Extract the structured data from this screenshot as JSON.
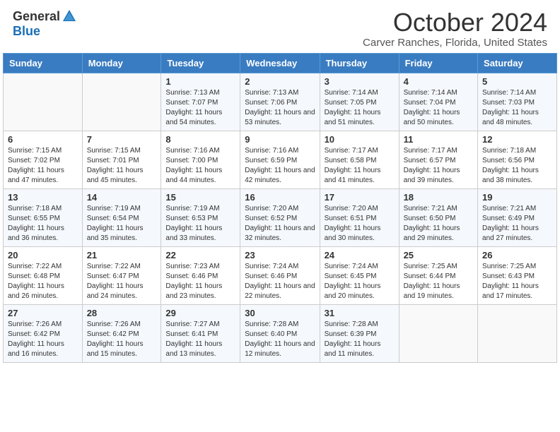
{
  "header": {
    "logo_general": "General",
    "logo_blue": "Blue",
    "month_title": "October 2024",
    "location": "Carver Ranches, Florida, United States"
  },
  "days_of_week": [
    "Sunday",
    "Monday",
    "Tuesday",
    "Wednesday",
    "Thursday",
    "Friday",
    "Saturday"
  ],
  "weeks": [
    [
      {
        "day": "",
        "info": ""
      },
      {
        "day": "",
        "info": ""
      },
      {
        "day": "1",
        "info": "Sunrise: 7:13 AM\nSunset: 7:07 PM\nDaylight: 11 hours and 54 minutes."
      },
      {
        "day": "2",
        "info": "Sunrise: 7:13 AM\nSunset: 7:06 PM\nDaylight: 11 hours and 53 minutes."
      },
      {
        "day": "3",
        "info": "Sunrise: 7:14 AM\nSunset: 7:05 PM\nDaylight: 11 hours and 51 minutes."
      },
      {
        "day": "4",
        "info": "Sunrise: 7:14 AM\nSunset: 7:04 PM\nDaylight: 11 hours and 50 minutes."
      },
      {
        "day": "5",
        "info": "Sunrise: 7:14 AM\nSunset: 7:03 PM\nDaylight: 11 hours and 48 minutes."
      }
    ],
    [
      {
        "day": "6",
        "info": "Sunrise: 7:15 AM\nSunset: 7:02 PM\nDaylight: 11 hours and 47 minutes."
      },
      {
        "day": "7",
        "info": "Sunrise: 7:15 AM\nSunset: 7:01 PM\nDaylight: 11 hours and 45 minutes."
      },
      {
        "day": "8",
        "info": "Sunrise: 7:16 AM\nSunset: 7:00 PM\nDaylight: 11 hours and 44 minutes."
      },
      {
        "day": "9",
        "info": "Sunrise: 7:16 AM\nSunset: 6:59 PM\nDaylight: 11 hours and 42 minutes."
      },
      {
        "day": "10",
        "info": "Sunrise: 7:17 AM\nSunset: 6:58 PM\nDaylight: 11 hours and 41 minutes."
      },
      {
        "day": "11",
        "info": "Sunrise: 7:17 AM\nSunset: 6:57 PM\nDaylight: 11 hours and 39 minutes."
      },
      {
        "day": "12",
        "info": "Sunrise: 7:18 AM\nSunset: 6:56 PM\nDaylight: 11 hours and 38 minutes."
      }
    ],
    [
      {
        "day": "13",
        "info": "Sunrise: 7:18 AM\nSunset: 6:55 PM\nDaylight: 11 hours and 36 minutes."
      },
      {
        "day": "14",
        "info": "Sunrise: 7:19 AM\nSunset: 6:54 PM\nDaylight: 11 hours and 35 minutes."
      },
      {
        "day": "15",
        "info": "Sunrise: 7:19 AM\nSunset: 6:53 PM\nDaylight: 11 hours and 33 minutes."
      },
      {
        "day": "16",
        "info": "Sunrise: 7:20 AM\nSunset: 6:52 PM\nDaylight: 11 hours and 32 minutes."
      },
      {
        "day": "17",
        "info": "Sunrise: 7:20 AM\nSunset: 6:51 PM\nDaylight: 11 hours and 30 minutes."
      },
      {
        "day": "18",
        "info": "Sunrise: 7:21 AM\nSunset: 6:50 PM\nDaylight: 11 hours and 29 minutes."
      },
      {
        "day": "19",
        "info": "Sunrise: 7:21 AM\nSunset: 6:49 PM\nDaylight: 11 hours and 27 minutes."
      }
    ],
    [
      {
        "day": "20",
        "info": "Sunrise: 7:22 AM\nSunset: 6:48 PM\nDaylight: 11 hours and 26 minutes."
      },
      {
        "day": "21",
        "info": "Sunrise: 7:22 AM\nSunset: 6:47 PM\nDaylight: 11 hours and 24 minutes."
      },
      {
        "day": "22",
        "info": "Sunrise: 7:23 AM\nSunset: 6:46 PM\nDaylight: 11 hours and 23 minutes."
      },
      {
        "day": "23",
        "info": "Sunrise: 7:24 AM\nSunset: 6:46 PM\nDaylight: 11 hours and 22 minutes."
      },
      {
        "day": "24",
        "info": "Sunrise: 7:24 AM\nSunset: 6:45 PM\nDaylight: 11 hours and 20 minutes."
      },
      {
        "day": "25",
        "info": "Sunrise: 7:25 AM\nSunset: 6:44 PM\nDaylight: 11 hours and 19 minutes."
      },
      {
        "day": "26",
        "info": "Sunrise: 7:25 AM\nSunset: 6:43 PM\nDaylight: 11 hours and 17 minutes."
      }
    ],
    [
      {
        "day": "27",
        "info": "Sunrise: 7:26 AM\nSunset: 6:42 PM\nDaylight: 11 hours and 16 minutes."
      },
      {
        "day": "28",
        "info": "Sunrise: 7:26 AM\nSunset: 6:42 PM\nDaylight: 11 hours and 15 minutes."
      },
      {
        "day": "29",
        "info": "Sunrise: 7:27 AM\nSunset: 6:41 PM\nDaylight: 11 hours and 13 minutes."
      },
      {
        "day": "30",
        "info": "Sunrise: 7:28 AM\nSunset: 6:40 PM\nDaylight: 11 hours and 12 minutes."
      },
      {
        "day": "31",
        "info": "Sunrise: 7:28 AM\nSunset: 6:39 PM\nDaylight: 11 hours and 11 minutes."
      },
      {
        "day": "",
        "info": ""
      },
      {
        "day": "",
        "info": ""
      }
    ]
  ]
}
